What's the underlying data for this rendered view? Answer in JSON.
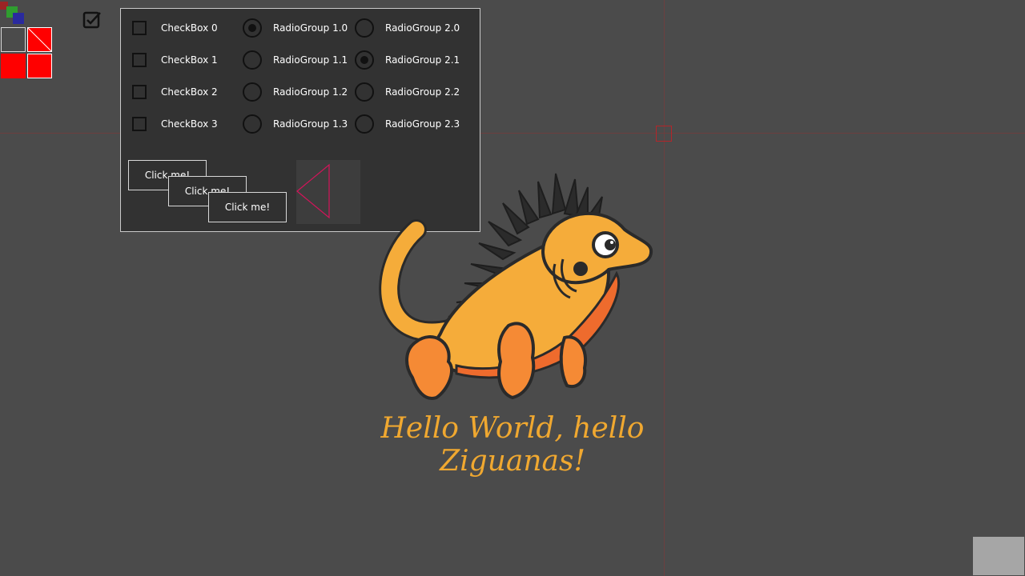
{
  "checkboxes": [
    {
      "label": "CheckBox 0",
      "checked": false
    },
    {
      "label": "CheckBox 1",
      "checked": false
    },
    {
      "label": "CheckBox 2",
      "checked": false
    },
    {
      "label": "CheckBox 3",
      "checked": false
    }
  ],
  "radio_group_1": [
    {
      "label": "RadioGroup 1.0",
      "selected": true
    },
    {
      "label": "RadioGroup 1.1",
      "selected": false
    },
    {
      "label": "RadioGroup 1.2",
      "selected": false
    },
    {
      "label": "RadioGroup 1.3",
      "selected": false
    }
  ],
  "radio_group_2": [
    {
      "label": "RadioGroup 2.0",
      "selected": false
    },
    {
      "label": "RadioGroup 2.1",
      "selected": true
    },
    {
      "label": "RadioGroup 2.2",
      "selected": false
    },
    {
      "label": "RadioGroup 2.3",
      "selected": false
    }
  ],
  "buttons": [
    {
      "label": "Click me!"
    },
    {
      "label": "Click me!"
    },
    {
      "label": "Click me!"
    }
  ],
  "greeting": "Hello World, hello Ziguanas!",
  "colors": {
    "background": "#4b4b4b",
    "panel": "#323232",
    "accent": "#f0a830",
    "triangle": "#d4145a",
    "tile_red": "#ff0000"
  },
  "icons": [
    "logo-icon",
    "checkbox-checked-icon",
    "triangle-icon",
    "iguana-illustration"
  ]
}
